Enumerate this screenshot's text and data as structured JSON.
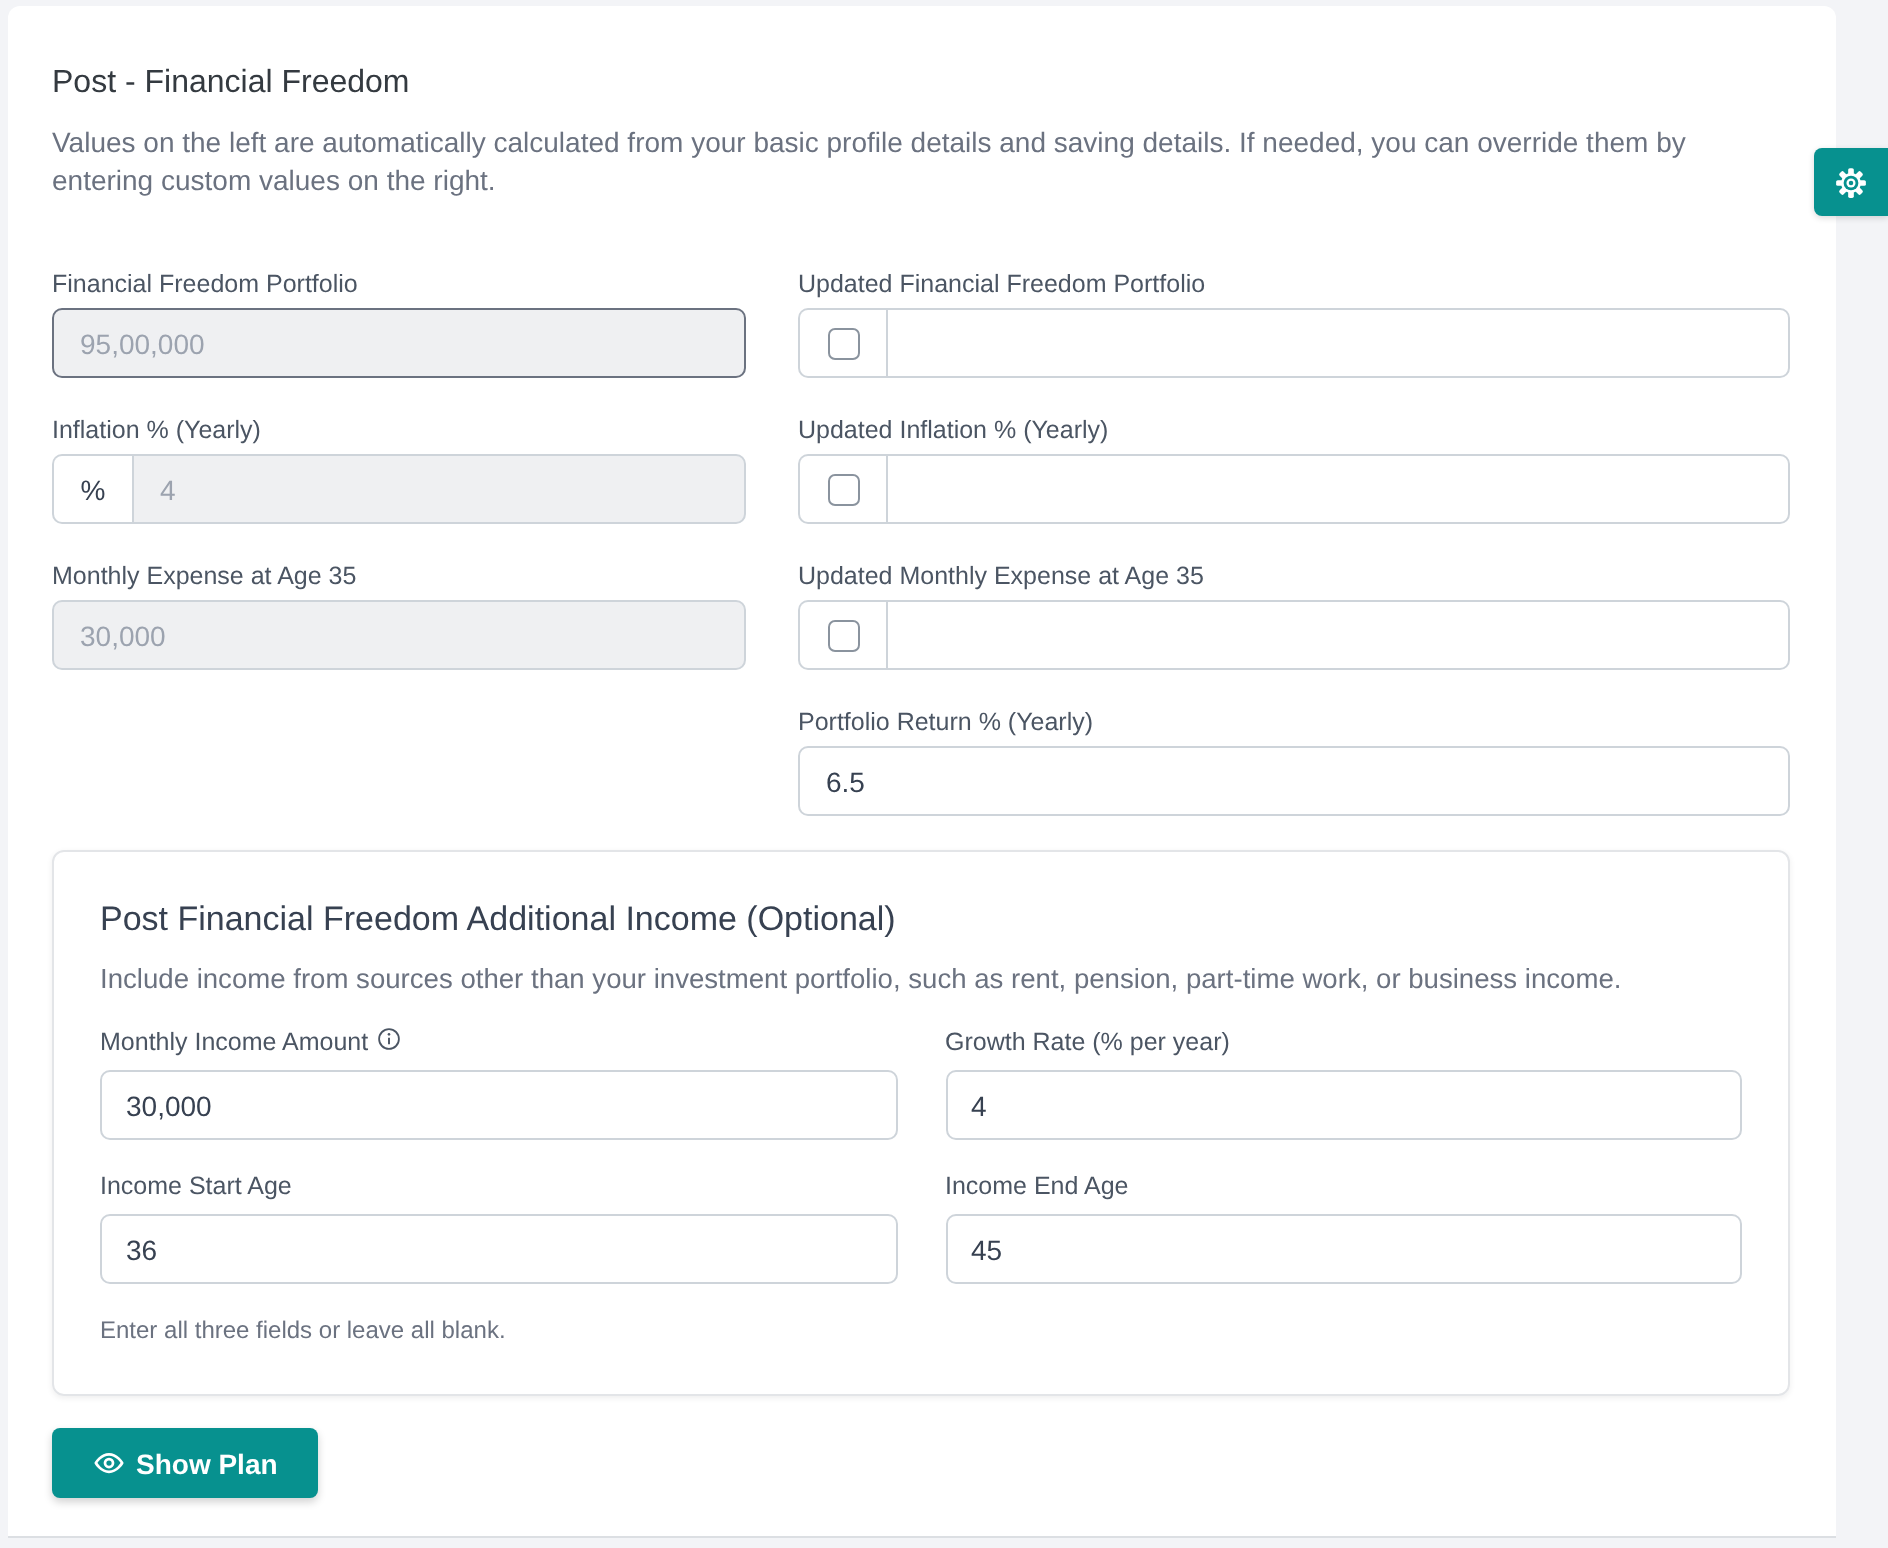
{
  "section": {
    "title": "Post - Financial Freedom",
    "description": "Values on the left are automatically calculated from your basic profile details and saving details. If needed, you can override them by entering custom values on the right."
  },
  "calculated": [
    {
      "label": "Financial Freedom Portfolio",
      "kind": "plain",
      "value": "95,00,000",
      "disabled": true,
      "focused": true
    },
    {
      "label": "Inflation % (Yearly)",
      "kind": "prefixed",
      "prefix": "%",
      "value": "4",
      "disabled": true,
      "focused": false
    },
    {
      "label": "Monthly Expense at Age 35",
      "kind": "plain",
      "value": "30,000",
      "disabled": true,
      "focused": false
    }
  ],
  "overrides": [
    {
      "label": "Updated Financial Freedom Portfolio",
      "kind": "override",
      "checked": false
    },
    {
      "label": "Updated Inflation % (Yearly)",
      "kind": "override",
      "checked": false
    },
    {
      "label": "Updated Monthly Expense at Age 35",
      "kind": "override",
      "checked": false
    },
    {
      "label": "Portfolio Return % (Yearly)",
      "kind": "input",
      "value": "6.5"
    }
  ],
  "additional_income": {
    "title": "Post Financial Freedom Additional Income (Optional)",
    "description": "Include income from sources other than your investment portfolio, such as rent, pension, part-time work, or business income.",
    "fields": [
      {
        "label": "Monthly Income Amount",
        "info": true,
        "value": "30,000"
      },
      {
        "label": "Growth Rate (% per year)",
        "info": false,
        "value": "4"
      },
      {
        "label": "Income Start Age",
        "info": false,
        "value": "36"
      },
      {
        "label": "Income End Age",
        "info": false,
        "value": "45"
      }
    ],
    "note": "Enter all three fields or leave all blank."
  },
  "primary_button": {
    "label": "Show Plan"
  }
}
